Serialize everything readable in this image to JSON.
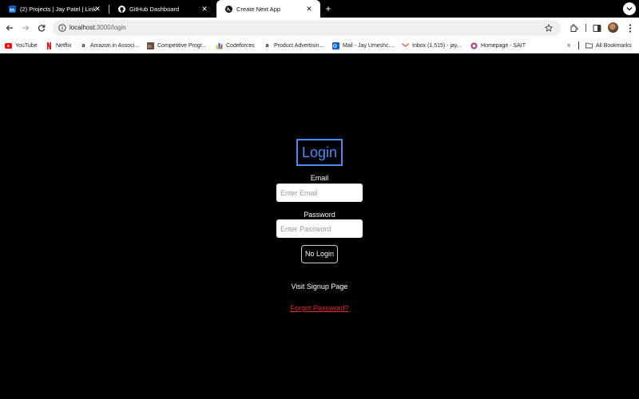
{
  "browser": {
    "tabs": [
      {
        "title": "(2) Projects | Jay Patel | LinkedIn",
        "icon": "linkedin-icon",
        "active": false
      },
      {
        "title": "GitHub Dashboard",
        "icon": "github-icon",
        "active": false
      },
      {
        "title": "Create Next App",
        "icon": "nextjs-icon",
        "active": true
      }
    ],
    "new_tab_label": "+",
    "url": {
      "host": "localhost",
      "path": ":3000/login"
    },
    "bookmarks": [
      {
        "label": "YouTube",
        "icon": "youtube-icon"
      },
      {
        "label": "Netflix",
        "icon": "netflix-icon"
      },
      {
        "label": "Amazon.in Associ...",
        "icon": "amazon-icon"
      },
      {
        "label": "Competitive Progr...",
        "icon": "competitive-programming-icon"
      },
      {
        "label": "Codeforces",
        "icon": "codeforces-icon"
      },
      {
        "label": "Product Advertisin...",
        "icon": "amazon-icon"
      },
      {
        "label": "Mail - Jay Umeshc...",
        "icon": "outlook-icon"
      },
      {
        "label": "Inbox (1,515) - jay...",
        "icon": "gmail-icon"
      },
      {
        "label": "Homepage - SAIT",
        "icon": "sait-icon"
      }
    ],
    "more_bookmarks": "»",
    "all_bookmarks_label": "All Bookmarks"
  },
  "login": {
    "title": "Login",
    "email_label": "Email",
    "email_placeholder": "Enter Email",
    "email_value": "",
    "password_label": "Password",
    "password_placeholder": "Enter Password",
    "password_value": "",
    "submit_label": "No Login",
    "signup_link": "Visit Signup Page",
    "forgot_link": "Forgot Password?"
  },
  "colors": {
    "page_background": "#000000",
    "title_accent": "#4b8cf0",
    "forgot_link": "#e03030"
  }
}
